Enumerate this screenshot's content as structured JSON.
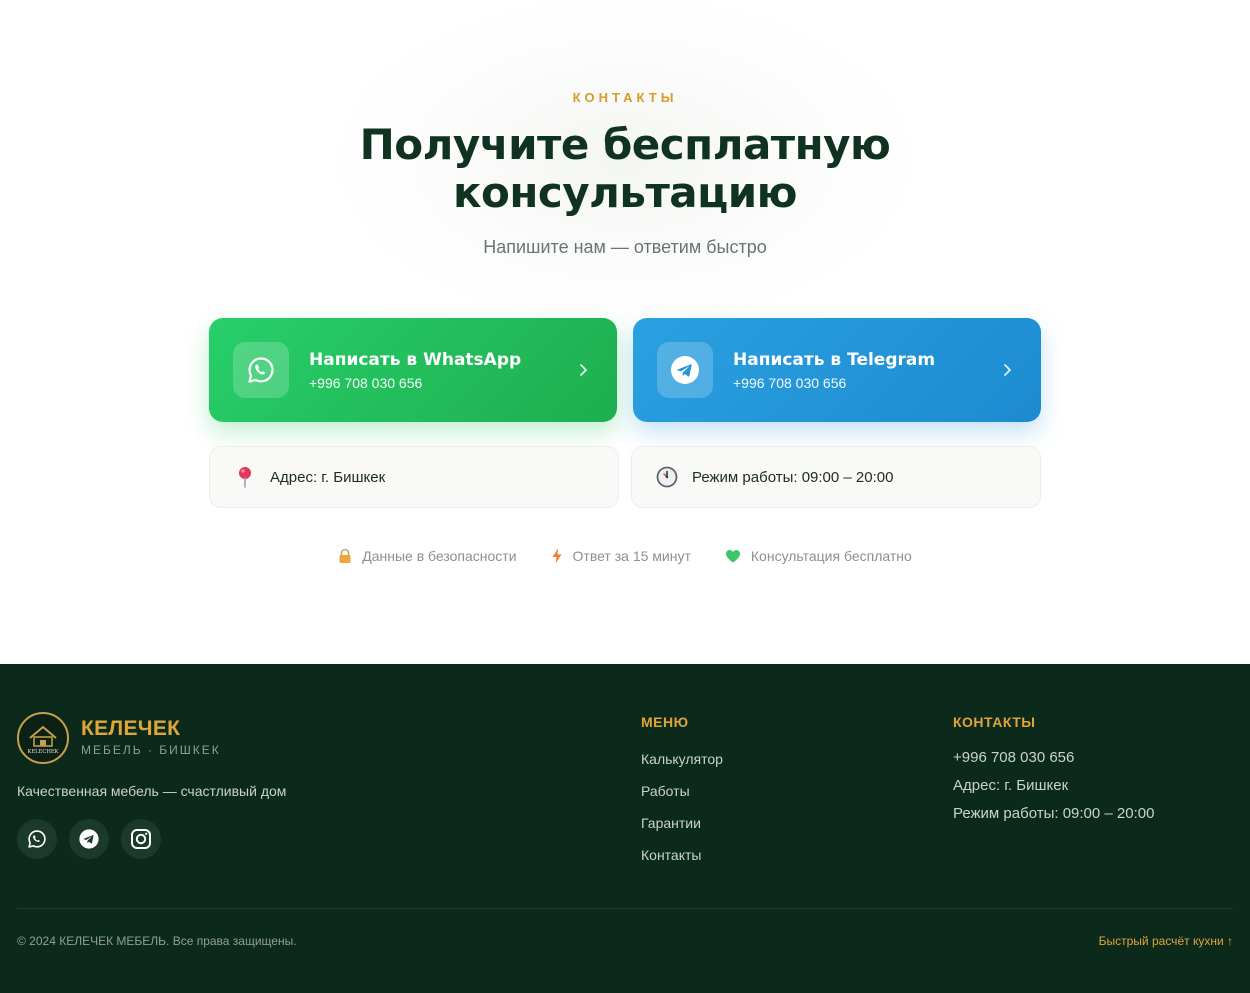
{
  "contacts": {
    "eyebrow": "КОНТАКТЫ",
    "headline_line1": "Получите бесплатную",
    "headline_line2": "консультацию",
    "subtitle": "Напишите нам — ответим быстро",
    "whatsapp": {
      "title": "Написать в WhatsApp",
      "phone": "+996 708 030 656",
      "color": "#25c863",
      "icon": "whatsapp-icon"
    },
    "telegram": {
      "title": "Написать в Telegram",
      "phone": "+996 708 030 656",
      "color": "#2496d8",
      "icon": "telegram-icon"
    },
    "address": "Адрес: г. Бишкек",
    "hours": "Режим работы: 09:00 – 20:00",
    "badges": [
      {
        "icon": "lock-icon",
        "label": "Данные в безопасности"
      },
      {
        "icon": "lightning-icon",
        "label": "Ответ за 15 минут"
      },
      {
        "icon": "heart-icon",
        "label": "Консультация бесплатно"
      }
    ]
  },
  "footer": {
    "brand_name": "КЕЛЕЧЕК",
    "brand_sub": "МЕБЕЛЬ · БИШКЕК",
    "tagline": "Качественная мебель — счастливый дом",
    "menu_title": "МЕНЮ",
    "menu_items": [
      "Калькулятор",
      "Работы",
      "Гарантии",
      "Контакты"
    ],
    "contacts_title": "КОНТАКТЫ",
    "phone": "+996 708 030 656",
    "address": "Адрес: г. Бишкек",
    "hours": "Режим работы: 09:00 – 20:00",
    "copyright": "© 2024 КЕЛЕЧЕК МЕБЕЛЬ. Все права защищены.",
    "quick_link": "Быстрый расчёт кухни ↑",
    "logo_text": "KELECHEK"
  },
  "colors": {
    "accent": "#e0a53a",
    "dark_green": "#0c2a1b",
    "heading": "#0f3320"
  }
}
